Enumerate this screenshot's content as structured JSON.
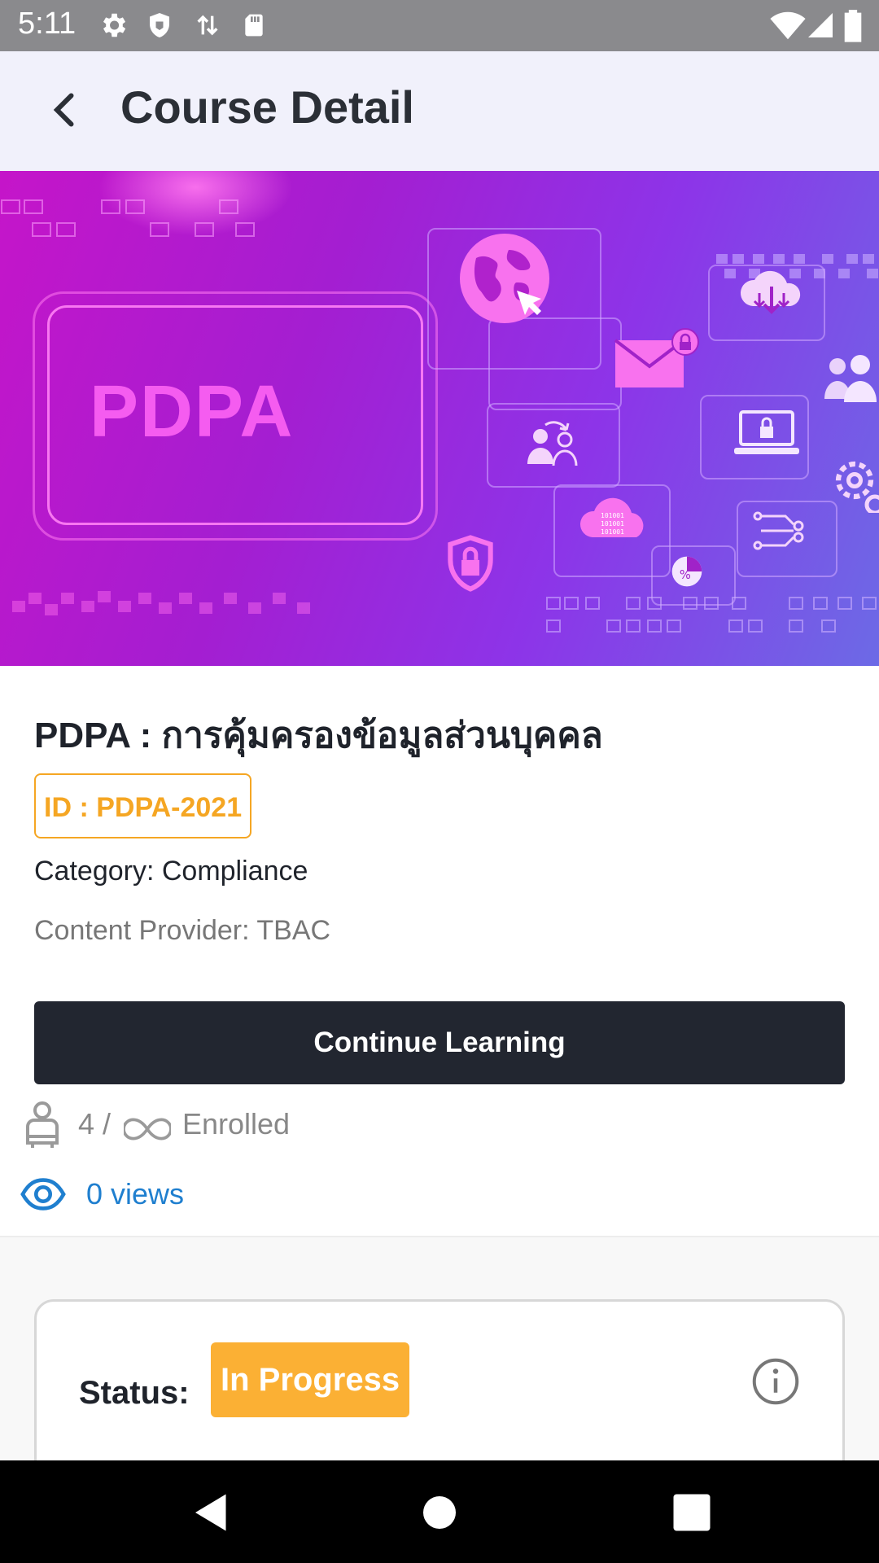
{
  "status_bar": {
    "time": "5:11",
    "icons": [
      "gear-icon",
      "shield-icon",
      "data-transfer-icon",
      "sd-card-icon",
      "wifi-icon",
      "signal-icon",
      "battery-icon"
    ]
  },
  "app_bar": {
    "title": "Course Detail",
    "back_icon": "chevron-left-icon"
  },
  "banner": {
    "text": "PDPA",
    "icons": [
      "globe-icon",
      "mail-lock-icon",
      "cloud-download-icon",
      "users-icon",
      "user-sync-icon",
      "laptop-lock-icon",
      "cloud-binary-icon",
      "gear-icon",
      "shield-lock-icon",
      "circuit-icon",
      "pie-chart-icon"
    ]
  },
  "course": {
    "title": "PDPA : การคุ้มครองข้อมูลส่วนบุคคล",
    "id_label": "ID : PDPA-2021",
    "category": "Category: Compliance",
    "provider": "Content Provider: TBAC",
    "cta_label": "Continue Learning",
    "enrolled_count": "4 /",
    "enrolled_label": "Enrolled",
    "views": "0 views"
  },
  "status_card": {
    "label": "Status:",
    "value": "In Progress"
  },
  "colors": {
    "accent_orange": "#f5a623",
    "status_pill": "#fbb034",
    "cta_bg": "#222630",
    "views_blue": "#1f7fcf",
    "app_bar_bg": "#f1f1fb",
    "banner_start": "#c515c9",
    "banner_end": "#6c6ae6"
  }
}
